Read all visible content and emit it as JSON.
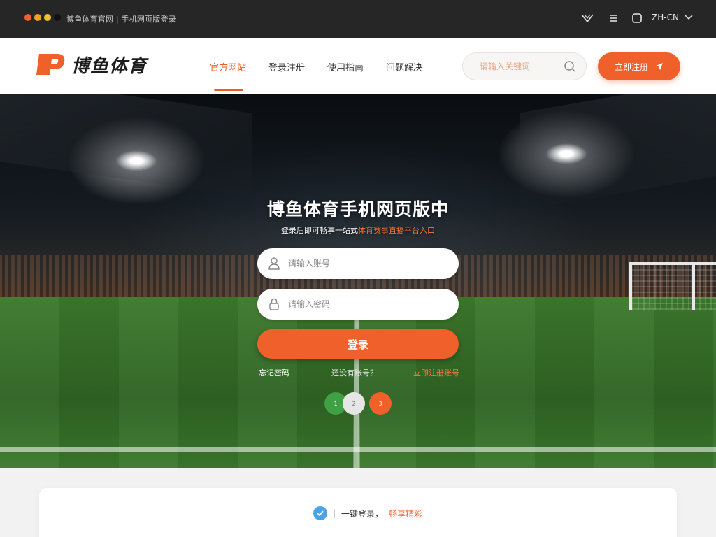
{
  "browser": {
    "title": "博鱼体育官网 | 手机网页版登录",
    "language": "ZH-CN",
    "dots": [
      "#f0602b",
      "#f0a02b",
      "#f0c02b",
      "#111111"
    ]
  },
  "header": {
    "logo_text": "博鱼体育",
    "nav": [
      "官方网站",
      "登录注册",
      "使用指南",
      "问题解决"
    ],
    "active_nav": 0,
    "search_placeholder": "请输入关键词",
    "cta_label": "立即注册"
  },
  "hero": {
    "title": "博鱼体育手机网页版中",
    "subtitle_plain": "登录后即可畅享一站式",
    "subtitle_highlight": "体育赛事直播平台入口",
    "username_placeholder": "请输入账号",
    "password_placeholder": "请输入密码",
    "login_label": "登录",
    "link_left": "忘记密码",
    "link_middle": "还没有账号？",
    "link_right": "立即注册账号",
    "pager": [
      "1",
      "2",
      "3"
    ]
  },
  "bottom": {
    "text_plain": "一键登录，",
    "text_highlight": "畅享精彩"
  },
  "colors": {
    "accent": "#f0602b",
    "green": "#3fa044",
    "chrome": "#262626"
  }
}
